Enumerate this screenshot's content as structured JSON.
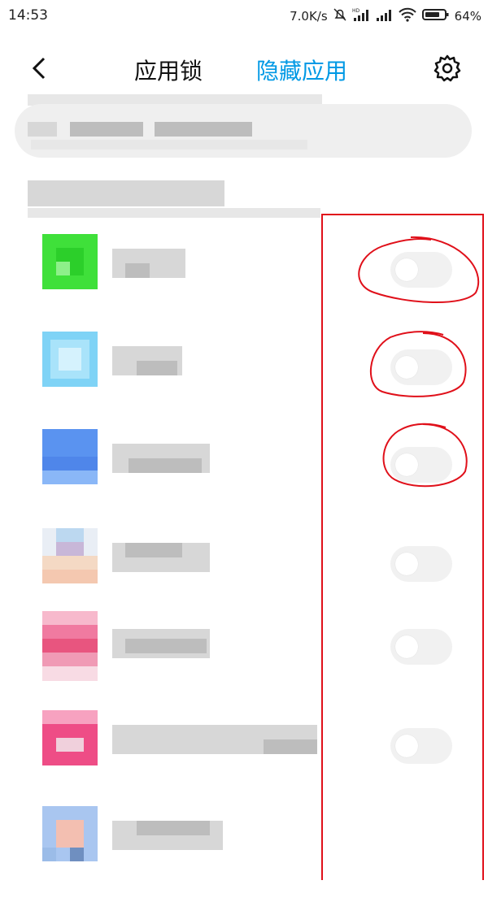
{
  "status_bar": {
    "time": "14:53",
    "net_speed": "7.0K/s",
    "battery": "64%"
  },
  "header": {
    "tab_app_lock": "应用锁",
    "tab_hidden_apps": "隐藏应用",
    "accent_color": "#0099e5"
  },
  "icons": [
    "back-arrow-icon",
    "gear-icon",
    "mute-bell-icon",
    "hd-signal-icon",
    "signal-icon",
    "wifi-icon",
    "battery-icon"
  ],
  "app_list": [
    {
      "icon_colors": [
        "#3fe03a",
        "#2ccf2a",
        "#8ef08a"
      ],
      "toggle_on": false,
      "circled": true
    },
    {
      "icon_colors": [
        "#7fd3f6",
        "#a9e3fa",
        "#d5f2fd"
      ],
      "toggle_on": false,
      "circled": true
    },
    {
      "icon_colors": [
        "#5a93f0",
        "#4f86ea",
        "#8ab7f7"
      ],
      "toggle_on": false,
      "circled": true
    },
    {
      "icon_colors": [
        "#c8b7d8",
        "#f4c8b0",
        "#bcd8f0"
      ],
      "toggle_on": false,
      "circled": false
    },
    {
      "icon_colors": [
        "#f07aa0",
        "#e8557f",
        "#f7b9cc"
      ],
      "toggle_on": false,
      "circled": false
    },
    {
      "icon_colors": [
        "#ee4d86",
        "#f7a2c0",
        "#f0d0dc"
      ],
      "toggle_on": false,
      "circled": false
    },
    {
      "icon_colors": [
        "#a9c6f0",
        "#f3bfb1",
        "#9bbce8"
      ],
      "toggle_on": null,
      "circled": false
    }
  ],
  "annotation_color": "#e0101a"
}
